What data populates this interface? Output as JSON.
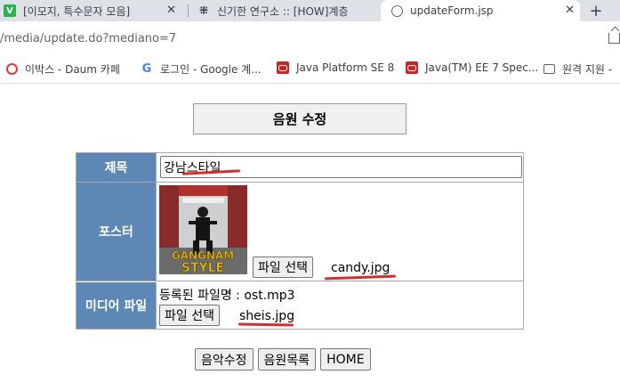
{
  "browser": {
    "tabs": [
      {
        "title": "[이모지, 특수문자 모음]",
        "icon": "v-icon",
        "active": false
      },
      {
        "title": "신기한 연구소 :: [HOW]계층",
        "icon": "tistory-icon",
        "active": false
      },
      {
        "title": "updateForm.jsp",
        "icon": "globe-icon",
        "active": true
      }
    ],
    "new_tab_label": "+",
    "url": "/media/update.do?mediano=7",
    "bookmarks": [
      {
        "label": "이박스 - Daum 카페",
        "icon": "daum-icon"
      },
      {
        "label": "로그인 - Google 계...",
        "icon": "google-icon"
      },
      {
        "label": "Java Platform SE 8",
        "icon": "oracle-icon"
      },
      {
        "label": "Java(TM) EE 7 Spec...",
        "icon": "oracle-icon"
      },
      {
        "label": "원격 지원 -",
        "icon": "remote-icon"
      }
    ]
  },
  "page": {
    "heading": "음원 수정",
    "form": {
      "title_label": "제목",
      "title_value": "강남스타일",
      "poster_label": "포스터",
      "poster_file_button": "파일 선택",
      "poster_file_name": "candy.jpg",
      "media_label": "미디어 파일",
      "registered_file_text": "등록된 파일명 : ost.mp3",
      "media_file_button": "파일 선택",
      "media_file_name": "sheis.jpg"
    },
    "buttons": {
      "submit": "음악수정",
      "list": "음원목록",
      "home": "HOME"
    },
    "poster_text": {
      "top": "GANGNAM",
      "bottom": "STYLE"
    }
  },
  "colors": {
    "header_cell": "#5d87b5",
    "annotation_red": "#d32f2f"
  }
}
